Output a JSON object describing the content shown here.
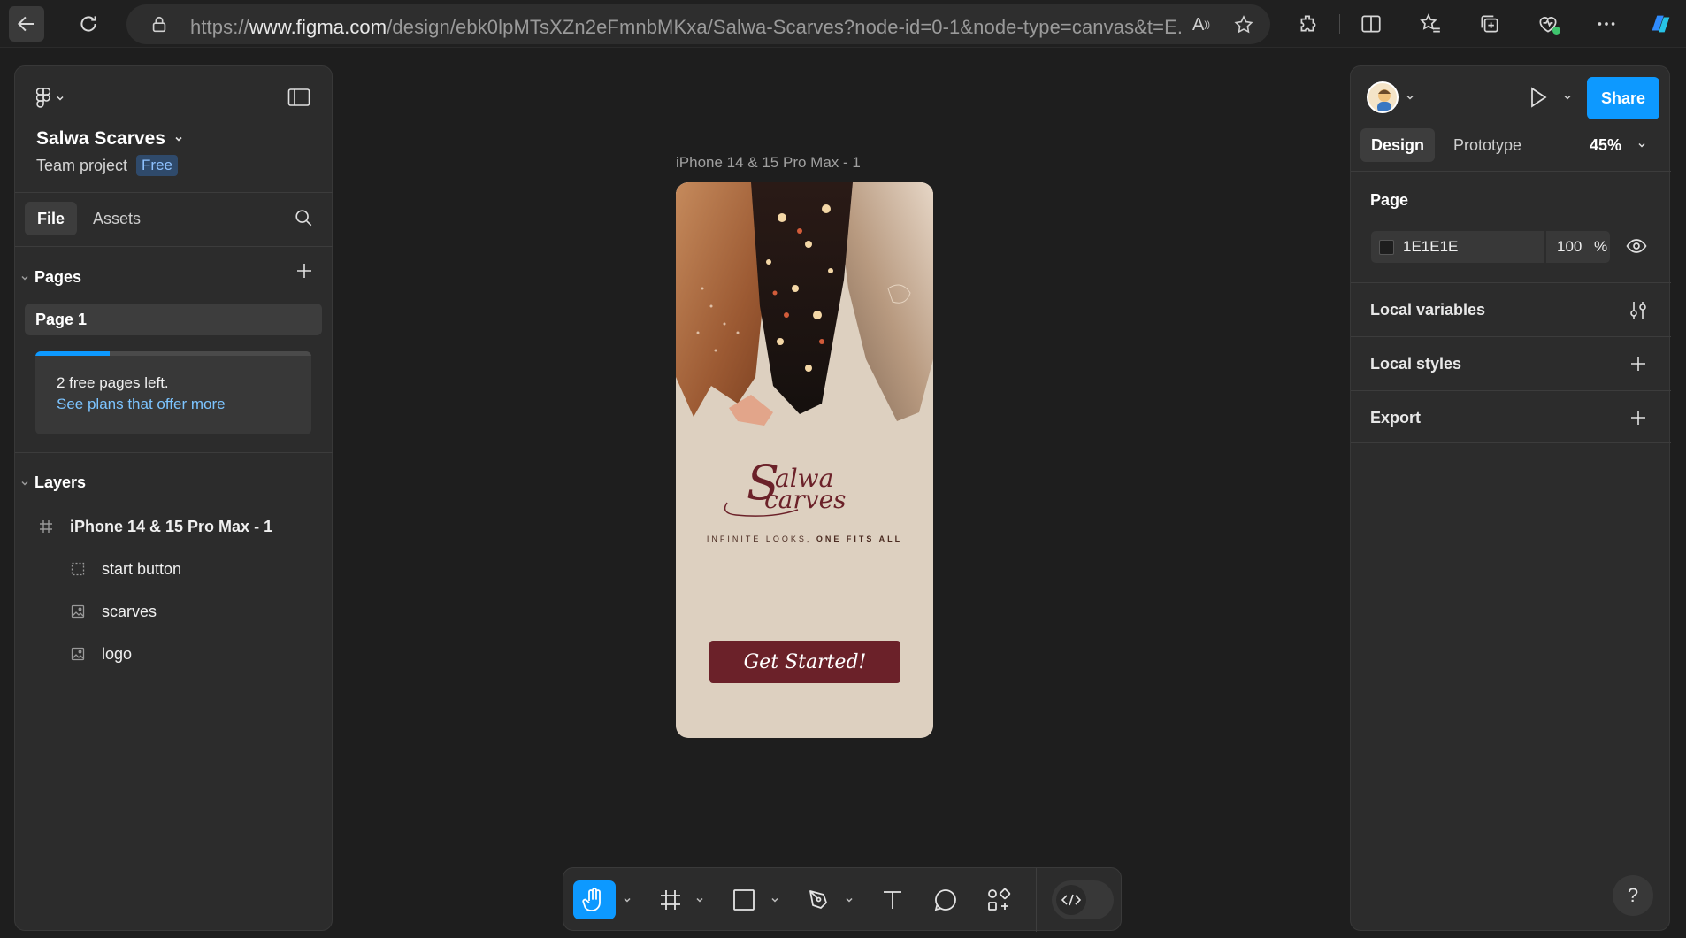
{
  "browser": {
    "url_prefix": "https://",
    "url_domain": "www.figma.com",
    "url_path": "/design/ebk0lpMTsXZn2eFmnbMKxa/Salwa-Scarves?node-id=0-1&node-type=canvas&t=E...",
    "read_aloud_label": "A"
  },
  "left_panel": {
    "file_title": "Salwa Scarves",
    "team": "Team project",
    "plan_badge": "Free",
    "tabs": {
      "file": "File",
      "assets": "Assets"
    },
    "pages_header": "Pages",
    "pages": [
      "Page 1"
    ],
    "upsell": {
      "progress_fraction": 0.27,
      "line1": "2 free pages left.",
      "link": "See plans that offer more"
    },
    "layers_header": "Layers",
    "layers": [
      {
        "name": "iPhone 14 & 15 Pro Max - 1",
        "icon": "frame-icon"
      },
      {
        "name": "start button",
        "icon": "dashed-frame-icon"
      },
      {
        "name": "scarves",
        "icon": "image-icon"
      },
      {
        "name": "logo",
        "icon": "image-icon"
      }
    ]
  },
  "canvas": {
    "frame_label": "iPhone 14 & 15 Pro Max - 1",
    "frame_bg": "#DDD0C0",
    "logo_script_1": "Salwa",
    "logo_script_2": "Scarves",
    "tagline_light": "INFINITE LOOKS, ",
    "tagline_bold": "ONE FITS ALL",
    "cta_label": "Get Started!",
    "cta_color": "#6B2129"
  },
  "right_panel": {
    "share_label": "Share",
    "tabs": {
      "design": "Design",
      "prototype": "Prototype"
    },
    "zoom": "45%",
    "page_label": "Page",
    "page_color_hex": "1E1E1E",
    "page_opacity": "100",
    "page_opacity_unit": "%",
    "rows": {
      "variables": "Local variables",
      "styles": "Local styles",
      "export": "Export"
    },
    "help": "?"
  },
  "colors": {
    "accent": "#0D99FF",
    "panel": "#2C2C2C",
    "canvas": "#1E1E1E"
  }
}
